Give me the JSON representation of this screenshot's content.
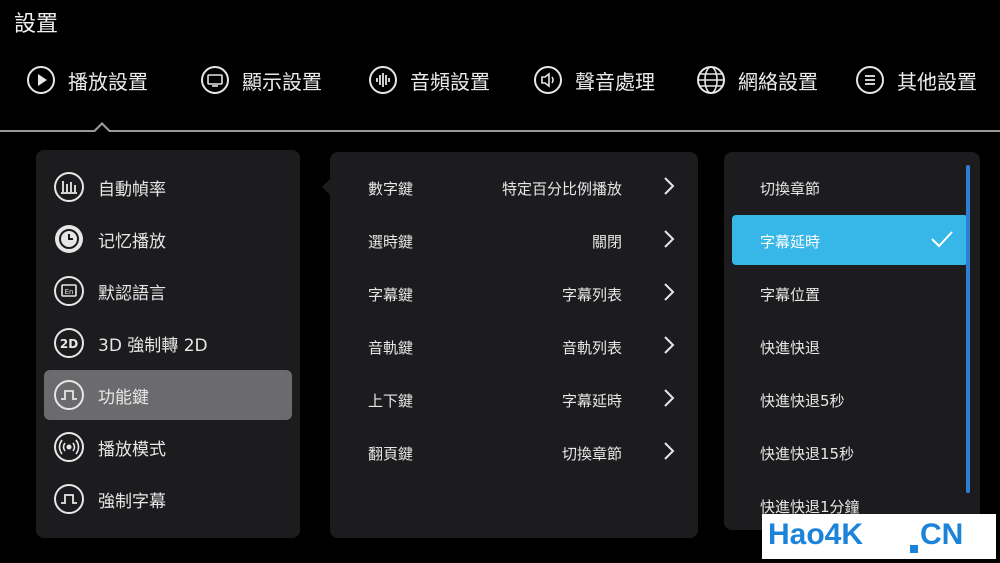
{
  "page": {
    "title": "設置"
  },
  "tabs": [
    {
      "label": "播放設置",
      "icon": "play-circle-icon",
      "active": true
    },
    {
      "label": "顯示設置",
      "icon": "monitor-icon"
    },
    {
      "label": "音頻設置",
      "icon": "audio-wave-icon"
    },
    {
      "label": "聲音處理",
      "icon": "speaker-icon"
    },
    {
      "label": "網絡設置",
      "icon": "globe-icon"
    },
    {
      "label": "其他設置",
      "icon": "list-icon"
    }
  ],
  "menu": {
    "items": [
      {
        "label": "自動幀率",
        "icon": "bar-chart-icon"
      },
      {
        "label": "记忆播放",
        "icon": "clock-icon"
      },
      {
        "label": "默認語言",
        "icon": "language-icon"
      },
      {
        "label": "3D 強制轉 2D",
        "icon": "3d-2d-icon",
        "icon_text": "2D"
      },
      {
        "label": "功能鍵",
        "icon": "function-key-icon",
        "selected": true
      },
      {
        "label": "播放模式",
        "icon": "broadcast-icon"
      },
      {
        "label": "強制字幕",
        "icon": "subtitle-icon"
      }
    ]
  },
  "keys": {
    "rows": [
      {
        "key": "數字鍵",
        "value": "特定百分比例播放"
      },
      {
        "key": "選時鍵",
        "value": "關閉"
      },
      {
        "key": "字幕鍵",
        "value": "字幕列表"
      },
      {
        "key": "音軌鍵",
        "value": "音軌列表"
      },
      {
        "key": "上下鍵",
        "value": "字幕延時"
      },
      {
        "key": "翻頁鍵",
        "value": "切換章節"
      }
    ]
  },
  "options": {
    "items": [
      {
        "label": "切換章節"
      },
      {
        "label": "字幕延時",
        "selected": true
      },
      {
        "label": "字幕位置"
      },
      {
        "label": "快進快退"
      },
      {
        "label": "快進快退5秒"
      },
      {
        "label": "快進快退15秒"
      },
      {
        "label": "快進快退1分鐘"
      }
    ]
  },
  "watermark": {
    "left": "Hao4K",
    "right": "CN"
  },
  "colors": {
    "accent": "#37b6e8",
    "scrollbar": "#2d7fd3",
    "watermark": "#1b83d8",
    "panel": "#1c1c1f"
  }
}
